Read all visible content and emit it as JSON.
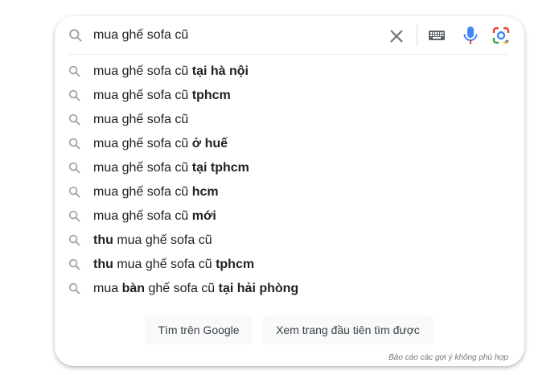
{
  "search": {
    "query": "mua ghế sofa cũ",
    "clear_icon": "close-icon",
    "keyboard_icon": "keyboard-icon",
    "mic_icon": "microphone-icon",
    "lens_icon": "google-lens-icon"
  },
  "suggestions": [
    {
      "parts": [
        {
          "t": "mua ghế sofa cũ ",
          "b": false
        },
        {
          "t": "tại hà nội",
          "b": true
        }
      ]
    },
    {
      "parts": [
        {
          "t": "mua ghế sofa cũ ",
          "b": false
        },
        {
          "t": "tphcm",
          "b": true
        }
      ]
    },
    {
      "parts": [
        {
          "t": "mua ghế sofa cũ",
          "b": false
        }
      ]
    },
    {
      "parts": [
        {
          "t": "mua ghế sofa cũ ",
          "b": false
        },
        {
          "t": "ở huế",
          "b": true
        }
      ]
    },
    {
      "parts": [
        {
          "t": "mua ghế sofa cũ ",
          "b": false
        },
        {
          "t": "tại tphcm",
          "b": true
        }
      ]
    },
    {
      "parts": [
        {
          "t": "mua ghế sofa cũ ",
          "b": false
        },
        {
          "t": "hcm",
          "b": true
        }
      ]
    },
    {
      "parts": [
        {
          "t": "mua ghế sofa cũ ",
          "b": false
        },
        {
          "t": "mới",
          "b": true
        }
      ]
    },
    {
      "parts": [
        {
          "t": "thu",
          "b": true
        },
        {
          "t": " mua ghế sofa cũ",
          "b": false
        }
      ]
    },
    {
      "parts": [
        {
          "t": "thu",
          "b": true
        },
        {
          "t": " mua ghế sofa cũ ",
          "b": false
        },
        {
          "t": "tphcm",
          "b": true
        }
      ]
    },
    {
      "parts": [
        {
          "t": "mua ",
          "b": false
        },
        {
          "t": "bàn",
          "b": true
        },
        {
          "t": " ghế sofa cũ ",
          "b": false
        },
        {
          "t": "tại hải phòng",
          "b": true
        }
      ]
    }
  ],
  "buttons": {
    "google_search": "Tìm trên Google",
    "feeling_lucky": "Xem trang đầu tiên tìm được"
  },
  "report_link": "Báo cáo các gợi ý không phù hợp",
  "colors": {
    "mic_blue": "#4285f4",
    "mic_red": "#ea4335",
    "lens_yellow": "#fbbc04",
    "lens_green": "#34a853",
    "icon_gray": "#9aa0a6"
  }
}
